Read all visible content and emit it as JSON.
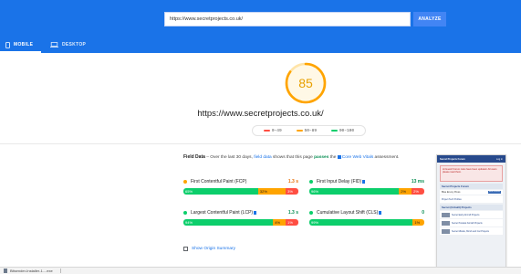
{
  "header": {
    "url_value": "https://www.secretprojects.co.uk/",
    "analyze_label": "ANALYZE",
    "tabs": [
      {
        "label": "MOBILE",
        "icon": "phone-icon",
        "active": true
      },
      {
        "label": "DESKTOP",
        "icon": "laptop-icon",
        "active": false
      }
    ]
  },
  "score": {
    "value": "85",
    "fraction": 0.85,
    "color": "#ffa400",
    "url": "https://www.secretprojects.co.uk/"
  },
  "legend": [
    {
      "label": "0–49",
      "color": "#ff4e42"
    },
    {
      "label": "50–89",
      "color": "#ffa400"
    },
    {
      "label": "90–100",
      "color": "#0cce6b"
    }
  ],
  "field": {
    "title": "Field Data",
    "text_1": " – Over the last 30 days, ",
    "link": "field data",
    "text_2": " shows that this page ",
    "passes": "passes",
    "text_3": " the ",
    "cwv_link": "Core Web Vitals",
    "text_4": " assessment."
  },
  "metrics": [
    {
      "name": "First Contentful Paint (FCP)",
      "value": "1.3 s",
      "status": "orange",
      "flag": false,
      "bar": [
        {
          "label": "65%",
          "pct": 65
        },
        {
          "label": "32%",
          "pct": 32
        },
        {
          "label": "3%",
          "pct": 3
        }
      ]
    },
    {
      "name": "First Input Delay (FID)",
      "value": "13 ms",
      "status": "green",
      "flag": true,
      "bar": [
        {
          "label": "96%",
          "pct": 96
        },
        {
          "label": "2%",
          "pct": 2
        },
        {
          "label": "2%",
          "pct": 2
        }
      ]
    },
    {
      "name": "Largest Contentful Paint (LCP)",
      "value": "1.3 s",
      "status": "green",
      "flag": true,
      "bar": [
        {
          "label": "94%",
          "pct": 94
        },
        {
          "label": "4%",
          "pct": 4
        },
        {
          "label": "1%",
          "pct": 1
        }
      ]
    },
    {
      "name": "Cumulative Layout Shift (CLS)",
      "value": "0",
      "status": "green",
      "flag": true,
      "bar": [
        {
          "label": "99%",
          "pct": 99
        },
        {
          "label": "1%",
          "pct": 1
        },
        {
          "label": "",
          "pct": 0
        }
      ]
    }
  ],
  "origin_summary_label": "Show Origin Summary",
  "thumbnail": {
    "brand": "Secret Projects Forum",
    "login": "Log in",
    "notice": "Hi Guest! Forum rules have been updated. All users please read them.",
    "section_1": "Secret Projects Forum",
    "sub_1": "Blue Envoy Press",
    "sub_1_btn": "Mark forums",
    "entry_1": "Project Tech Profiles",
    "section_2": "Secret (Unbuilt) Projects",
    "entry_2": "Secret Early Aircraft Projects",
    "entry_3": "Secret Postwar Aircraft Projects",
    "entry_4": "Secret Missile, Bomb and Car Projects"
  },
  "taskbar": {
    "download_label": "Bitsender-Installer-1....exe"
  }
}
